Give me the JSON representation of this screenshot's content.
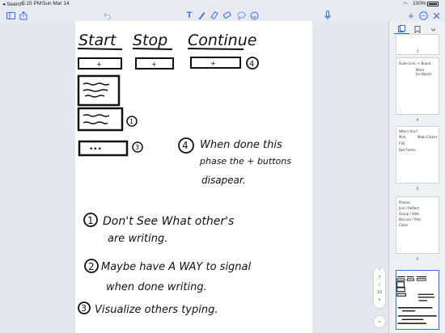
{
  "status_bar": {
    "back_label": "◂ Search",
    "time": "5:15 PM",
    "date": "Sun Mar 14",
    "battery": "100%"
  },
  "toolbar": {
    "icons": [
      "sidebar-icon",
      "share-icon",
      "undo-icon",
      "text-tool-icon",
      "pen-icon",
      "highlighter-icon",
      "eraser-icon",
      "lasso-icon",
      "sticker-icon",
      "microphone-icon",
      "add-icon",
      "more-icon",
      "close-icon"
    ],
    "accent_color": "#2f6df6"
  },
  "note": {
    "headings": [
      "Start",
      "Stop",
      "Continue"
    ],
    "plus": "+",
    "ellipsis": "•••",
    "marker_1": "1",
    "marker_3": "3",
    "marker_4": "4",
    "note4_line1": "When done this",
    "note4_line2": "phase the + buttons",
    "note4_line3": "disapear.",
    "item1_num": "1",
    "item1_line1": "Don't See What other's",
    "item1_line2": "are writing.",
    "item2_num": "2",
    "item2_line1": "Maybe have A WAY to signal",
    "item2_line2": "when done writing.",
    "item3_num": "3",
    "item3_line1": "Visualize others typing."
  },
  "sidebar": {
    "thumbs": [
      {
        "num": "3"
      },
      {
        "num": "4",
        "lines": [
          "Scale Link -> Board",
          "Mora",
          "Ice Board"
        ]
      },
      {
        "num": "5",
        "lines": [
          "Who's this?",
          "Miro",
          "Mobi Clicker",
          "FSS",
          "Dot Forms"
        ]
      },
      {
        "num": "6",
        "lines": [
          "Phases",
          "Join / Reflect",
          "Group / Vote",
          "Discuss / Plan",
          "Close"
        ]
      },
      {
        "num": ""
      }
    ],
    "scrubber": {
      "up": "^",
      "page_label": "7",
      "of": "/",
      "total": "15",
      "down": "v"
    }
  }
}
